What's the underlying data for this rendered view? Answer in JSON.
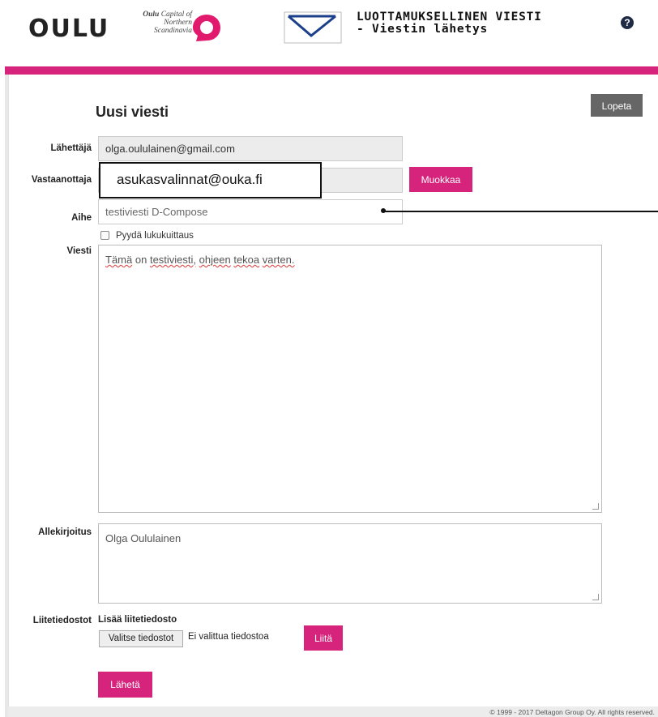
{
  "header": {
    "brand": "OULU",
    "tagline_bold": "Oulu",
    "tagline_rest": "Capital of Northern Scandinavia",
    "app_title_line1": "LUOTTAMUKSELLINEN VIESTI",
    "app_title_line2": "- Viestin lähetys",
    "help": "?"
  },
  "form": {
    "page_title": "Uusi viesti",
    "logout_label": "Lopeta",
    "sender_label": "Lähettäjä",
    "sender_value": "olga.oululainen@gmail.com",
    "recipient_label": "Vastaanottaja",
    "recipient_value": "asukasvalinnat@ouka.fi",
    "edit_label": "Muokkaa",
    "subject_label": "Aihe",
    "subject_value": "testiviesti D-Compose",
    "receipt_label": "Pyydä lukukuittaus",
    "message_label": "Viesti",
    "message_words": [
      "Tämä",
      "on",
      "testiviesti,",
      "ohjeen",
      "tekoa",
      "varten."
    ],
    "signature_label": "Allekirjoitus",
    "signature_value": "Olga Oululainen",
    "attachments_label": "Liitetiedostot",
    "add_attachment_label": "Lisää liitetiedosto",
    "choose_files_label": "Valitse tiedostot",
    "no_file_label": "Ei valittua tiedostoa",
    "attach_label": "Liitä",
    "send_label": "Lähetä"
  },
  "footer": {
    "copyright": "© 1999 - 2017 Deltagon Group Oy. All rights reserved."
  },
  "colors": {
    "accent": "#d6237b",
    "dark_button": "#666666",
    "field_bg": "#ececec"
  }
}
